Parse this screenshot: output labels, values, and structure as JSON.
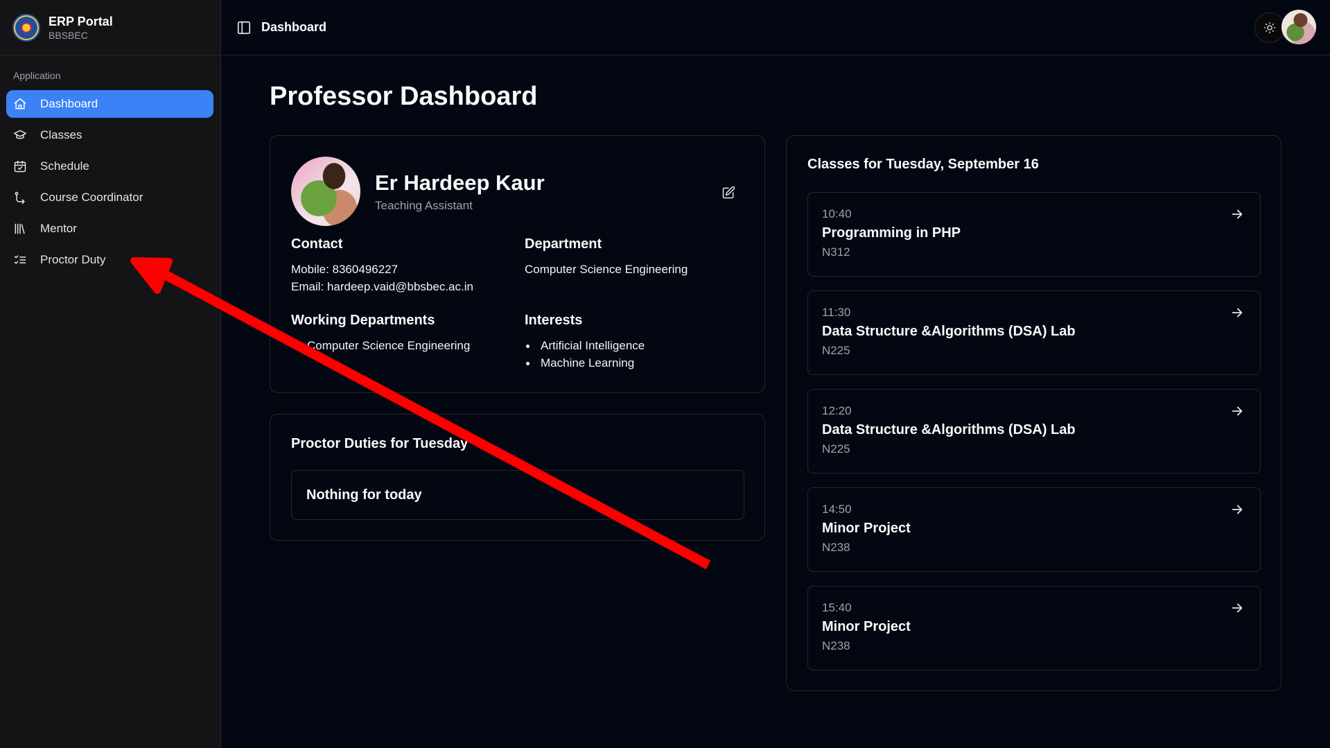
{
  "brand": {
    "title": "ERP Portal",
    "subtitle": "BBSBEC"
  },
  "sidebar": {
    "group_label": "Application",
    "items": [
      {
        "label": "Dashboard",
        "icon": "home-icon",
        "active": true
      },
      {
        "label": "Classes",
        "icon": "graduation-cap-icon",
        "active": false
      },
      {
        "label": "Schedule",
        "icon": "calendar-check-icon",
        "active": false
      },
      {
        "label": "Course Coordinator",
        "icon": "route-icon",
        "active": false
      },
      {
        "label": "Mentor",
        "icon": "library-icon",
        "active": false
      },
      {
        "label": "Proctor Duty",
        "icon": "list-checks-icon",
        "active": false
      }
    ]
  },
  "header": {
    "breadcrumb": "Dashboard",
    "theme_icon": "sun-icon"
  },
  "main": {
    "title": "Professor Dashboard",
    "profile": {
      "name": "Er Hardeep Kaur",
      "role": "Teaching Assistant",
      "contact_heading": "Contact",
      "mobile": "Mobile: 8360496227",
      "email": "Email: hardeep.vaid@bbsbec.ac.in",
      "department_heading": "Department",
      "department": "Computer Science Engineering",
      "working_heading": "Working Departments",
      "working_departments": [
        "Computer Science Engineering"
      ],
      "interests_heading": "Interests",
      "interests": [
        "Artificial Intelligence",
        "Machine Learning"
      ]
    },
    "proctor": {
      "heading": "Proctor Duties for Tuesday",
      "empty_text": "Nothing for today"
    },
    "classes": {
      "heading": "Classes for Tuesday, September 16",
      "items": [
        {
          "time": "10:40",
          "title": "Programming in PHP",
          "room": "N312"
        },
        {
          "time": "11:30",
          "title": "Data Structure &Algorithms (DSA) Lab",
          "room": "N225"
        },
        {
          "time": "12:20",
          "title": "Data Structure &Algorithms (DSA) Lab",
          "room": "N225"
        },
        {
          "time": "14:50",
          "title": "Minor Project",
          "room": "N238"
        },
        {
          "time": "15:40",
          "title": "Minor Project",
          "room": "N238"
        }
      ]
    }
  },
  "colors": {
    "background": "#030712",
    "sidebar": "#141416",
    "accent": "#3b82f6",
    "annotation_arrow": "#ff0000"
  }
}
